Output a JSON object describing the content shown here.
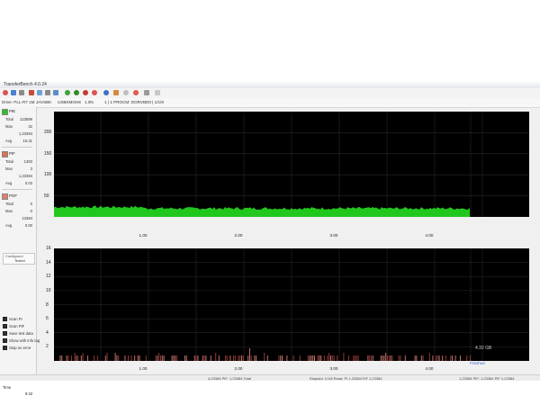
{
  "window": {
    "title": "TransferBench 4.0.24"
  },
  "infobar": {
    "drive": "Drive: PLL-R7 1M",
    "id": "JAVSBK",
    "model": "USBKMOH8",
    "rev": "1.0N",
    "disc": "1 | 1 PROCM: DORVBD0 | 1/1/8"
  },
  "sidebar": {
    "pie": {
      "label": "PIE",
      "rows": [
        {
          "k": "Total",
          "v": "123899"
        },
        {
          "k": "Max",
          "v": "42"
        },
        {
          "k": "",
          "v": "1,23384"
        },
        {
          "k": "Avg",
          "v": "15.31"
        }
      ]
    },
    "pif": {
      "label": "PIF",
      "rows": [
        {
          "k": "Total",
          "v": "1393"
        },
        {
          "k": "Max",
          "v": "3"
        },
        {
          "k": "",
          "v": "1,23384"
        },
        {
          "k": "Avg",
          "v": "0.03"
        }
      ]
    },
    "pof": {
      "label": "POF",
      "rows": [
        {
          "k": "Total",
          "v": "0"
        },
        {
          "k": "Max",
          "v": "0"
        },
        {
          "k": "",
          "v": "13384"
        },
        {
          "k": "Avg",
          "v": "0.00"
        }
      ]
    },
    "tested": {
      "label": "Configured",
      "value": "Tested"
    },
    "checkboxes": [
      "Scan PI",
      "Scan PIF",
      "Save test data",
      "Show with Info tag",
      "Stop on error"
    ],
    "time": {
      "label": "Time",
      "value": "9:42"
    }
  },
  "chart_data": [
    {
      "type": "area",
      "ylim": [
        0,
        250
      ],
      "yticks": [
        "200",
        "150",
        "100",
        "50"
      ],
      "xticks": [
        "1.00",
        "2.00",
        "3.00",
        "4.00"
      ],
      "series": [
        {
          "color": "#22c71e"
        }
      ]
    },
    {
      "type": "bar",
      "ylim": [
        0,
        16
      ],
      "yticks": [
        "16",
        "14",
        "12",
        "10",
        "8",
        "6",
        "4",
        "2"
      ],
      "xticks": [
        "1.00",
        "2.00",
        "3.00",
        "4.00"
      ],
      "marker": "4.32 GB",
      "end_label": "Finished"
    }
  ],
  "status": {
    "left": "4,23384 PIF: 1,23384 Total",
    "mid": "Elapsed: 1/1/8  Read: PI 1,23384 FIF 1,23384",
    "right": "1,23384 PIF: 1,23384 PIF 1,23384"
  },
  "colors": {
    "pie": "#22c71e",
    "pif": "#c0706a",
    "accent": "#d9534f"
  }
}
